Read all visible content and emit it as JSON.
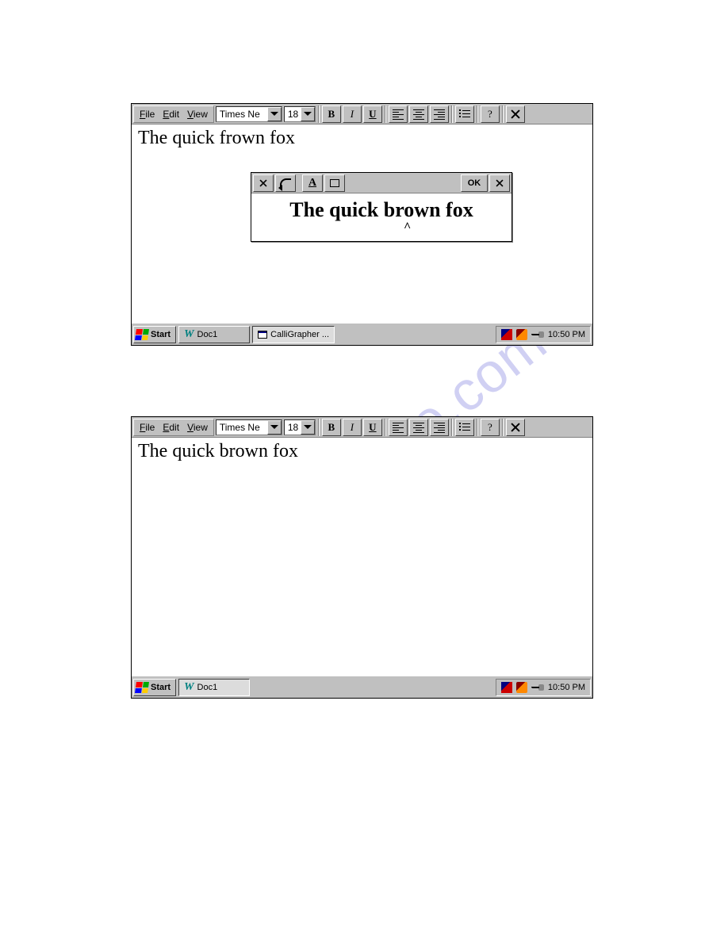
{
  "menu": {
    "file": "File",
    "edit": "Edit",
    "view": "View"
  },
  "toolbar": {
    "font": "Times Ne",
    "size": "18",
    "bold": "B",
    "italic": "I",
    "underline": "U",
    "help": "?"
  },
  "documents": {
    "top_text": "The quick frown fox",
    "bottom_text": "The quick brown fox"
  },
  "correction": {
    "text": "The quick brown fox",
    "ok": "OK",
    "caret": "^"
  },
  "taskbar": {
    "start": "Start",
    "doc1": "Doc1",
    "calligrapher": "CalliGrapher ...",
    "clock": "10:50 PM"
  },
  "watermark": "manualshive.com"
}
